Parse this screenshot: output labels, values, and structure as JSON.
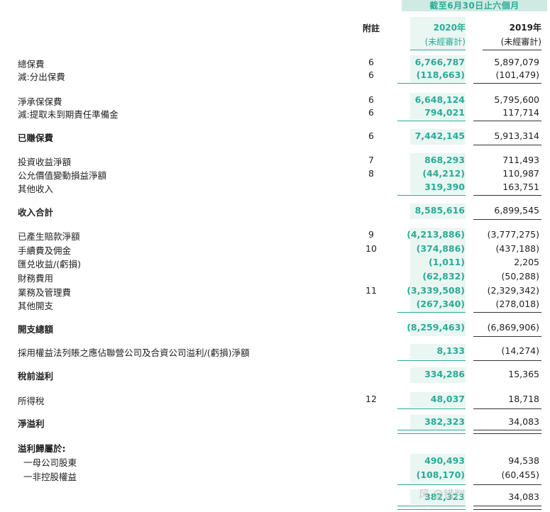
{
  "header": {
    "period": "截至6月30日止六個月",
    "note_col": "附註",
    "col_2020_year": "2020年",
    "col_2020_sub": "(未經審計)",
    "col_2019_year": "2019年",
    "col_2019_sub": "(未經審計)"
  },
  "rows": [
    {
      "label": "總保費",
      "note": "6",
      "v2020": "6,766,787",
      "v2019": "5,897,079"
    },
    {
      "label": "減:分出保費",
      "note": "6",
      "v2020": "(118,663)",
      "v2019": "(101,479)"
    },
    {
      "label": "淨承保保費",
      "note": "6",
      "v2020": "6,648,124",
      "v2019": "5,795,600"
    },
    {
      "label": "減:提取未到期責任準備金",
      "note": "6",
      "v2020": "794,021",
      "v2019": "117,714"
    },
    {
      "label": "已賺保費",
      "note": "6",
      "v2020": "7,442,145",
      "v2019": "5,913,314"
    },
    {
      "label": "投資收益淨額",
      "note": "7",
      "v2020": "868,293",
      "v2019": "711,493"
    },
    {
      "label": "公允價值變動損益淨額",
      "note": "8",
      "v2020": "(44,212)",
      "v2019": "110,987"
    },
    {
      "label": "其他收入",
      "note": "",
      "v2020": "319,390",
      "v2019": "163,751"
    },
    {
      "label": "收入合計",
      "note": "",
      "v2020": "8,585,616",
      "v2019": "6,899,545"
    },
    {
      "label": "已產生賠款淨額",
      "note": "9",
      "v2020": "(4,213,886)",
      "v2019": "(3,777,275)"
    },
    {
      "label": "手續費及佣金",
      "note": "10",
      "v2020": "(374,886)",
      "v2019": "(437,188)"
    },
    {
      "label": "匯兑收益/(虧損)",
      "note": "",
      "v2020": "(1,011)",
      "v2019": "2,205"
    },
    {
      "label": "財務費用",
      "note": "",
      "v2020": "(62,832)",
      "v2019": "(50,288)"
    },
    {
      "label": "業務及管理費",
      "note": "11",
      "v2020": "(3,339,508)",
      "v2019": "(2,329,342)"
    },
    {
      "label": "其他開支",
      "note": "",
      "v2020": "(267,340)",
      "v2019": "(278,018)"
    },
    {
      "label": "開支總額",
      "note": "",
      "v2020": "(8,259,463)",
      "v2019": "(6,869,906)"
    },
    {
      "label": "採用權益法列賬之應佔聯營公司及合資公司溢利/(虧損)淨額",
      "note": "",
      "v2020": "8,133",
      "v2019": "(14,274)"
    },
    {
      "label": "稅前溢利",
      "note": "",
      "v2020": "334,286",
      "v2019": "15,365"
    },
    {
      "label": "所得稅",
      "note": "12",
      "v2020": "48,037",
      "v2019": "18,718"
    },
    {
      "label": "淨溢利",
      "note": "",
      "v2020": "382,323",
      "v2019": "34,083"
    },
    {
      "label": "溢利歸屬於:",
      "note": "",
      "v2020": "",
      "v2019": ""
    },
    {
      "label": "一母公司股東",
      "note": "",
      "v2020": "490,493",
      "v2019": "94,538"
    },
    {
      "label": "一非控股權益",
      "note": "",
      "v2020": "(108,170)",
      "v2019": "(60,455)"
    },
    {
      "label": "",
      "note": "",
      "v2020": "382,323",
      "v2019": "34,083"
    }
  ],
  "watermark": "风 @错判"
}
